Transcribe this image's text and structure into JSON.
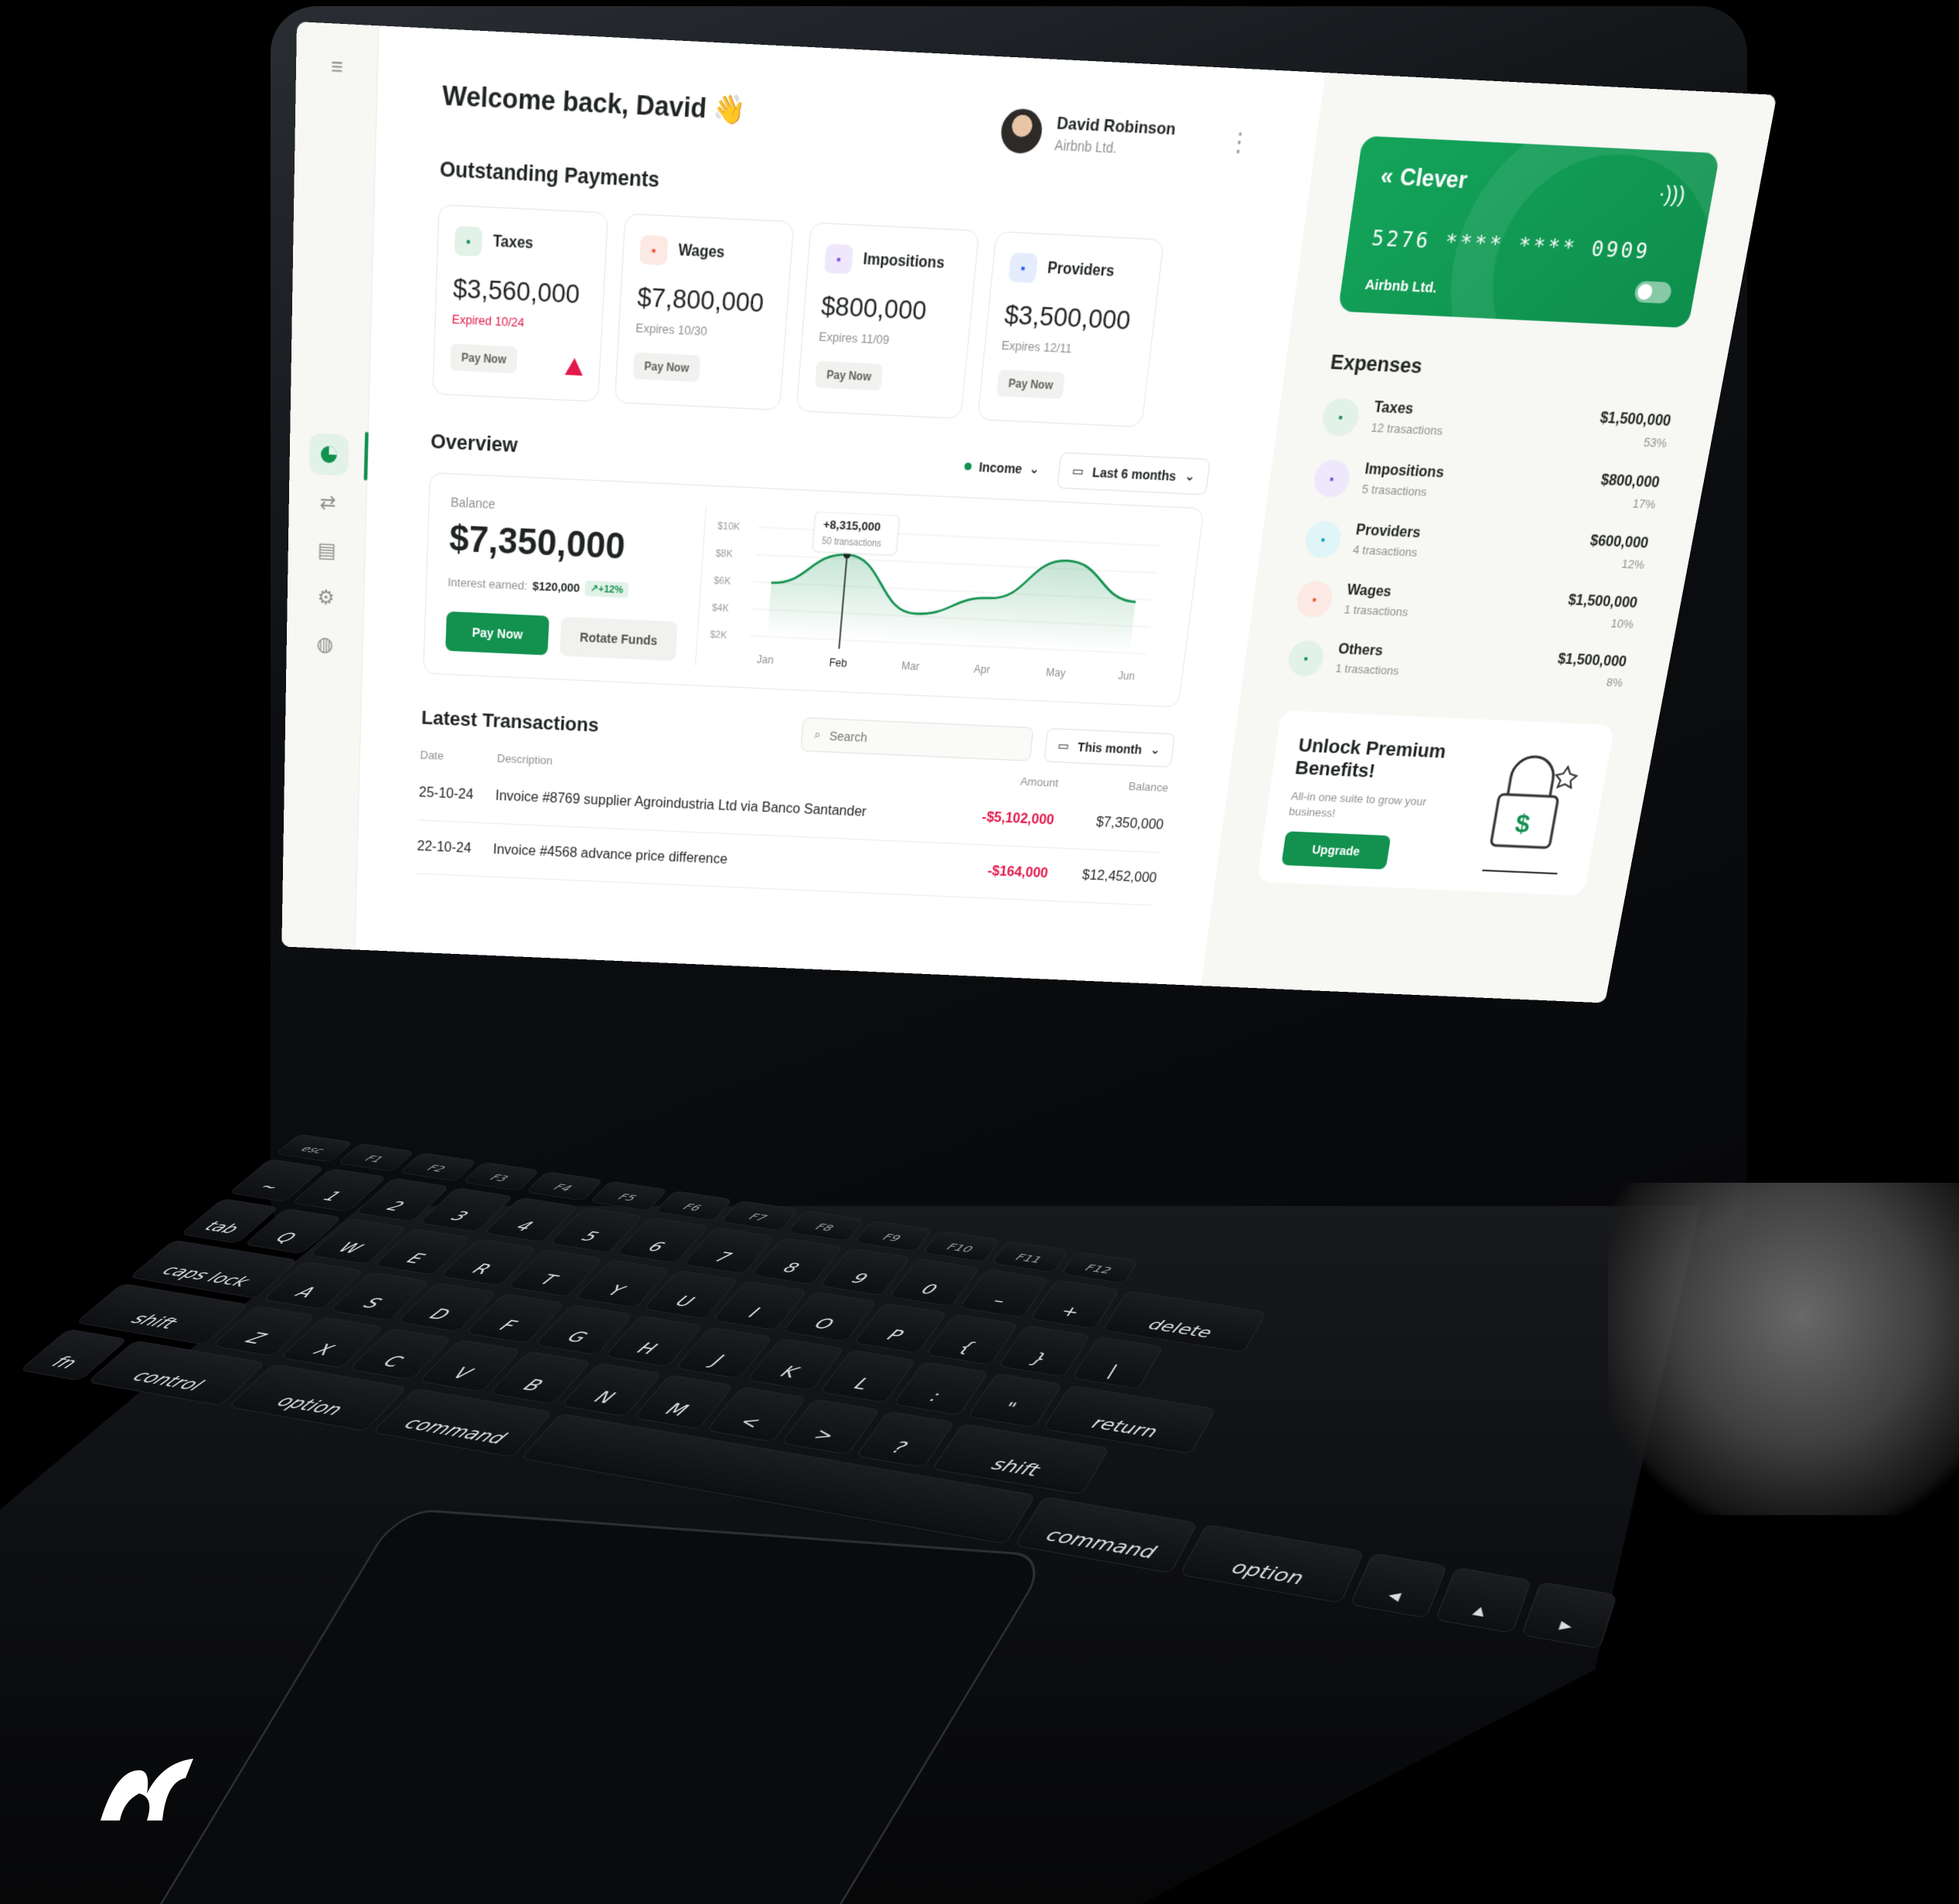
{
  "greeting": "Welcome back, David",
  "greeting_emoji": "👋",
  "user": {
    "name": "David Robinson",
    "org": "Airbnb Ltd."
  },
  "outstanding": {
    "title": "Outstanding Payments",
    "items": [
      {
        "name": "Taxes",
        "amount": "$3,560,000",
        "expiry": "Expired 10/24",
        "button": "Pay Now",
        "color": "#12914f",
        "bg": "#e3f2e8",
        "icon": "receipt-icon"
      },
      {
        "name": "Wages",
        "amount": "$7,800,000",
        "expiry": "Expires 10/30",
        "button": "Pay Now",
        "color": "#f0532c",
        "bg": "#fde9e3",
        "icon": "wallet-icon"
      },
      {
        "name": "Impositions",
        "amount": "$800,000",
        "expiry": "Expires 11/09",
        "button": "Pay Now",
        "color": "#7d4de0",
        "bg": "#efe8fc",
        "icon": "plus-box-icon"
      },
      {
        "name": "Providers",
        "amount": "$3,500,000",
        "expiry": "Expires 12/11",
        "button": "Pay Now",
        "color": "#1f5fe8",
        "bg": "#e5edfd",
        "icon": "upload-icon"
      }
    ]
  },
  "overview": {
    "title": "Overview",
    "filter": "Income",
    "range": "Last 6 months",
    "balance_label": "Balance",
    "balance": "$7,350,000",
    "interest_label": "Interest earned:",
    "interest": "$120,000",
    "interest_change": "+12%",
    "pay_button": "Pay Now",
    "rotate_button": "Rotate Funds",
    "tooltip_value": "+8,315,000",
    "tooltip_sub": "50 transactions"
  },
  "chart_data": {
    "type": "area",
    "categories": [
      "Jan",
      "Feb",
      "Mar",
      "Apr",
      "May",
      "Jun"
    ],
    "values": [
      6.0,
      8.3,
      4.2,
      5.6,
      8.6,
      5.8
    ],
    "yticks": [
      "$10K",
      "$8K",
      "$6K",
      "$4K",
      "$2K"
    ],
    "ylim": [
      2,
      10
    ],
    "highlight_category": "Feb",
    "grid": true
  },
  "transactions": {
    "title": "Latest Transactions",
    "search_placeholder": "Search",
    "range": "This month",
    "columns": {
      "date": "Date",
      "description": "Description",
      "amount": "Amount",
      "balance": "Balance"
    },
    "rows": [
      {
        "date": "25-10-24",
        "description": "Invoice #8769 supplier Agroindustria Ltd via Banco Santander",
        "amount": "-$5,102,000",
        "balance": "$7,350,000"
      },
      {
        "date": "22-10-24",
        "description": "Invoice #4568 advance price difference",
        "amount": "-$164,000",
        "balance": "$12,452,000"
      }
    ]
  },
  "card": {
    "brand": "Clever",
    "number": "5276 **** **** 0909",
    "org": "Airbnb Ltd."
  },
  "expenses": {
    "title": "Expenses",
    "items": [
      {
        "name": "Taxes",
        "sub": "12 trasactions",
        "amount": "$1,500,000",
        "pct": "53%",
        "color": "#12914f",
        "bg": "#e3f2e8"
      },
      {
        "name": "Impositions",
        "sub": "5 trasactions",
        "amount": "$800,000",
        "pct": "17%",
        "color": "#7d4de0",
        "bg": "#efe8fc"
      },
      {
        "name": "Providers",
        "sub": "4 trasactions",
        "amount": "$600,000",
        "pct": "12%",
        "color": "#0aa6b8",
        "bg": "#e0f5f7"
      },
      {
        "name": "Wages",
        "sub": "1 trasactions",
        "amount": "$1,500,000",
        "pct": "10%",
        "color": "#f0532c",
        "bg": "#fde9e3"
      },
      {
        "name": "Others",
        "sub": "1 trasactions",
        "amount": "$1,500,000",
        "pct": "8%",
        "color": "#12914f",
        "bg": "#e3f2e8"
      }
    ]
  },
  "premium": {
    "title": "Unlock Premium Benefits!",
    "sub": "All-in one suite to grow your business!",
    "button": "Upgrade"
  },
  "keyboard": {
    "fn_row": [
      "esc",
      "F1",
      "F2",
      "F3",
      "F4",
      "F5",
      "F6",
      "F7",
      "F8",
      "F9",
      "F10",
      "F11",
      "F12"
    ],
    "num_row": [
      "~",
      "1",
      "2",
      "3",
      "4",
      "5",
      "6",
      "7",
      "8",
      "9",
      "0",
      "–",
      "+",
      "delete"
    ],
    "q_row": [
      "tab",
      "Q",
      "W",
      "E",
      "R",
      "T",
      "Y",
      "U",
      "I",
      "O",
      "P",
      "{",
      "}",
      "|"
    ],
    "a_row": [
      "caps lock",
      "A",
      "S",
      "D",
      "F",
      "G",
      "H",
      "J",
      "K",
      "L",
      ":",
      "\"",
      "return"
    ],
    "z_row": [
      "shift",
      "Z",
      "X",
      "C",
      "V",
      "B",
      "N",
      "M",
      "<",
      ">",
      "?",
      "shift"
    ],
    "mod_row": [
      "fn",
      "control",
      "option",
      "command",
      "",
      "command",
      "option",
      "◂",
      "▴",
      "▸"
    ]
  },
  "colors": {
    "accent": "#12914f",
    "danger": "#e3184b"
  }
}
